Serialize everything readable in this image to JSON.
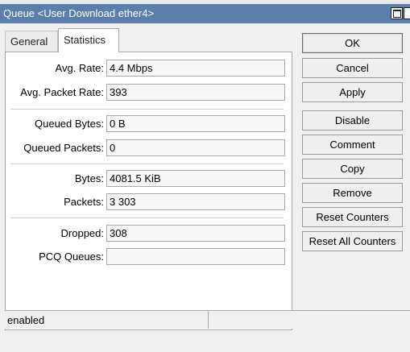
{
  "window": {
    "title": "Queue <User Download ether4>",
    "controls": {
      "maximize_icon": "maximize-icon",
      "close_label": "×"
    }
  },
  "tabs": [
    {
      "label": "General",
      "active": false
    },
    {
      "label": "Statistics",
      "active": true
    }
  ],
  "statistics": {
    "avg_rate": {
      "label": "Avg. Rate:",
      "value": "4.4 Mbps"
    },
    "avg_packet_rate": {
      "label": "Avg. Packet Rate:",
      "value": "393"
    },
    "queued_bytes": {
      "label": "Queued Bytes:",
      "value": "0 B"
    },
    "queued_packets": {
      "label": "Queued Packets:",
      "value": "0"
    },
    "bytes": {
      "label": "Bytes:",
      "value": "4081.5 KiB"
    },
    "packets": {
      "label": "Packets:",
      "value": "3 303"
    },
    "dropped": {
      "label": "Dropped:",
      "value": "308"
    },
    "pcq_queues": {
      "label": "PCQ Queues:",
      "value": ""
    }
  },
  "buttons": {
    "ok": "OK",
    "cancel": "Cancel",
    "apply": "Apply",
    "disable": "Disable",
    "comment": "Comment",
    "copy": "Copy",
    "remove": "Remove",
    "reset_counters": "Reset Counters",
    "reset_all_counters": "Reset All Counters"
  },
  "status_bar": {
    "status": "enabled"
  },
  "colors": {
    "titlebar": "#5c7eaa",
    "window_bg": "#f0f0f0",
    "field_bg": "#f7f7f7"
  }
}
